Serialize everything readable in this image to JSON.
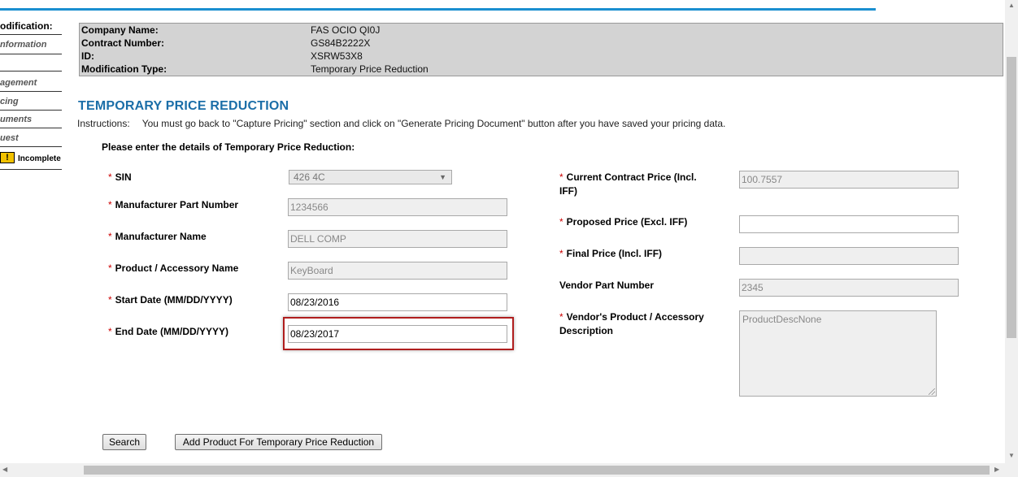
{
  "sidebar": {
    "title": "odification:",
    "items": [
      "nformation",
      "agement",
      "cing",
      "uments",
      "uest"
    ],
    "status_icon_text": "!",
    "status_label": "Incomplete"
  },
  "header": {
    "company_label": "Company Name:",
    "company_value": "FAS OCIO QI0J",
    "contract_label": "Contract Number:",
    "contract_value": "GS84B2222X",
    "id_label": "ID:",
    "id_value": "XSRW53X8",
    "modtype_label": "Modification Type:",
    "modtype_value": "Temporary Price Reduction"
  },
  "page": {
    "title": "TEMPORARY PRICE REDUCTION",
    "instructions_label": "Instructions:",
    "instructions_text": "You must go back to \"Capture Pricing\" section and click on \"Generate Pricing Document\" button after you have saved your pricing data.",
    "form_heading": "Please enter the details of Temporary Price Reduction:"
  },
  "form_left": {
    "required_mark": "*",
    "sin_label": "SIN",
    "sin_value": "426 4C",
    "sin_arrow": "▼",
    "mpn_label": "Manufacturer Part Number",
    "mpn_value": "1234566",
    "mfr_label": "Manufacturer Name",
    "mfr_value": "DELL COMP",
    "product_label": "Product / Accessory Name",
    "product_value": "KeyBoard",
    "start_label": "Start Date (MM/DD/YYYY)",
    "start_value": "08/23/2016",
    "end_label": "End Date (MM/DD/YYYY)",
    "end_value": "08/23/2017"
  },
  "form_right": {
    "current_label_1": "Current Contract Price (Incl.",
    "current_label_2": "IFF)",
    "current_value": "100.7557",
    "proposed_label": "Proposed Price (Excl. IFF)",
    "proposed_value": "",
    "final_label": "Final Price (Incl. IFF)",
    "final_value": "",
    "vpn_label": "Vendor Part Number",
    "vpn_value": "2345",
    "desc_label_1": "Vendor's Product / Accessory",
    "desc_label_2": "Description",
    "desc_value": "ProductDescNone"
  },
  "buttons": {
    "search": "Search",
    "add_product": "Add Product For Temporary Price Reduction"
  },
  "scrollbar": {
    "up": "▲",
    "down": "▼",
    "left": "◀",
    "right": "▶"
  },
  "colors": {
    "accent": "#1a8fd0",
    "heading": "#1b6ea8",
    "required": "#cc0000",
    "highlight": "#b01e1e",
    "warning": "#f2c200"
  }
}
